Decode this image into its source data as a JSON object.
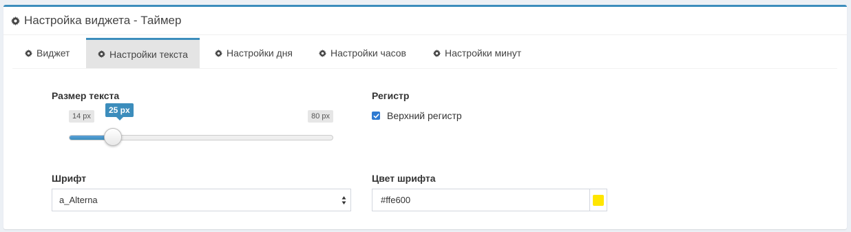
{
  "header": {
    "title": "Настройка виджета - Таймер"
  },
  "tabs": [
    {
      "label": "Виджет",
      "active": false
    },
    {
      "label": "Настройки текста",
      "active": true
    },
    {
      "label": "Настройки дня",
      "active": false
    },
    {
      "label": "Настройки часов",
      "active": false
    },
    {
      "label": "Настройки минут",
      "active": false
    }
  ],
  "text_size": {
    "label": "Размер текста",
    "min_label": "14 px",
    "max_label": "80 px",
    "value_label": "25 px",
    "min": 14,
    "max": 80,
    "value": 25
  },
  "register": {
    "label": "Регистр",
    "checkbox_label": "Верхний регистр",
    "checked": true
  },
  "font": {
    "label": "Шрифт",
    "selected": "a_Alterna"
  },
  "font_color": {
    "label": "Цвет шрифта",
    "value": "#ffe600"
  },
  "colors": {
    "accent": "#3c8dbc",
    "checkbox": "#2e7ad1"
  },
  "icons": {
    "header": "gear-icon",
    "tab": "gear-icon",
    "checkbox": "check-icon",
    "select": "sort-arrows-icon"
  }
}
